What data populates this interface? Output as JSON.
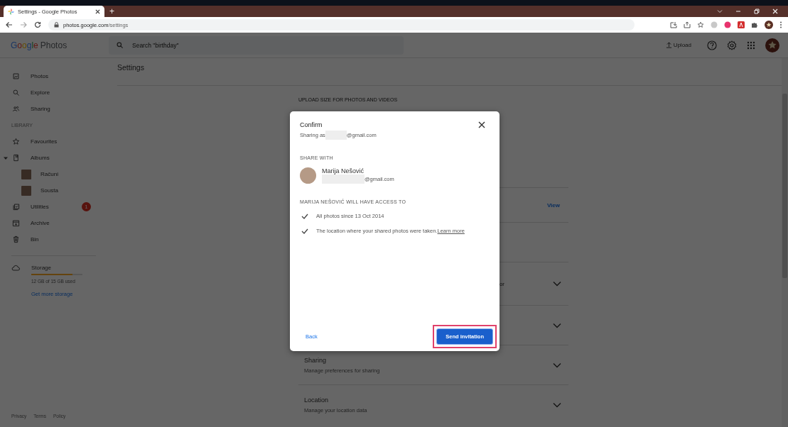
{
  "browser": {
    "tab": {
      "title": "Settings - Google Photos",
      "selected": true
    },
    "new_tab": "+",
    "url_host": "photos.google.com",
    "url_path": "/settings"
  },
  "app": {
    "logo": {
      "brand": "Google",
      "product": "Photos"
    },
    "search": {
      "placeholder": "Search \"birthday\""
    },
    "upload": "Upload"
  },
  "sidebar": {
    "items": [
      {
        "label": "Photos",
        "kind": "photo"
      },
      {
        "label": "Explore",
        "kind": "search"
      },
      {
        "label": "Sharing",
        "kind": "people"
      },
      {
        "kind": "section",
        "label": "LIBRARY"
      },
      {
        "label": "Favourites",
        "kind": "star"
      },
      {
        "label": "Albums",
        "kind": "album",
        "expanded": true,
        "children": [
          {
            "label": "Računi"
          },
          {
            "label": "Sousta"
          }
        ]
      },
      {
        "label": "Utilities",
        "kind": "utilities",
        "badge": "1"
      },
      {
        "label": "Archive",
        "kind": "archive"
      },
      {
        "label": "Bin",
        "kind": "bin"
      }
    ],
    "storage": {
      "label": "Storage",
      "level": 0.8,
      "usage": "12 GB of 15 GB used",
      "link": "Get more storage"
    },
    "footer": [
      "Privacy",
      "Terms",
      "Policy"
    ]
  },
  "page_title": "Settings",
  "settings": {
    "heading": "UPLOAD SIZE FOR PHOTOS AND VIDEOS",
    "rows": [
      {
        "action": "View"
      },
      {},
      {
        "fragment": "or",
        "expandable": true
      },
      {
        "expandable": true
      },
      {
        "title": "Sharing",
        "subtitle": "Manage preferences for sharing",
        "expandable": true
      },
      {
        "title": "Location",
        "subtitle": "Manage your location data",
        "expandable": true
      }
    ]
  },
  "dialog": {
    "title": "Confirm",
    "sharing_as": "Sharing as",
    "sharing_email_domain": "@gmail.com",
    "share_with_label": "SHARE WITH",
    "contact": {
      "name": "Marija Nešović",
      "email_domain": "@gmail.com"
    },
    "access_label": "MARIJA NEŠOVIĆ WILL HAVE ACCESS TO",
    "access_items": [
      {
        "text": "All photos since 13 Oct 2014"
      },
      {
        "text": "The location where your shared photos were taken.",
        "link": "Learn more"
      }
    ],
    "back": "Back",
    "send": {
      "label": "Send invitation",
      "highlighted": true
    }
  }
}
